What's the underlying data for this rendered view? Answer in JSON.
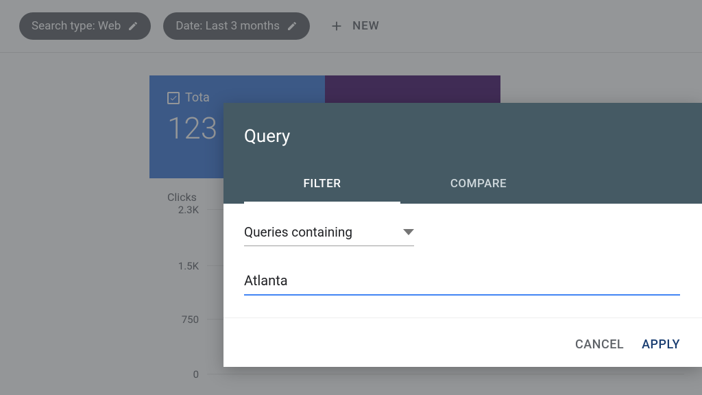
{
  "filters": {
    "search_type": "Search type: Web",
    "date": "Date: Last 3 months",
    "new_label": "NEW"
  },
  "metrics": {
    "total_label": "Tota",
    "total_value": "123"
  },
  "chart_data": {
    "type": "line",
    "ylabel": "Clicks",
    "ticks": [
      "2.3K",
      "1.5K",
      "750",
      "0"
    ],
    "ylim": [
      0,
      2300
    ]
  },
  "dialog": {
    "title": "Query",
    "tabs": {
      "filter": "FILTER",
      "compare": "COMPARE"
    },
    "select_label": "Queries containing",
    "input_value": "Atlanta",
    "cancel": "CANCEL",
    "apply": "APPLY"
  }
}
